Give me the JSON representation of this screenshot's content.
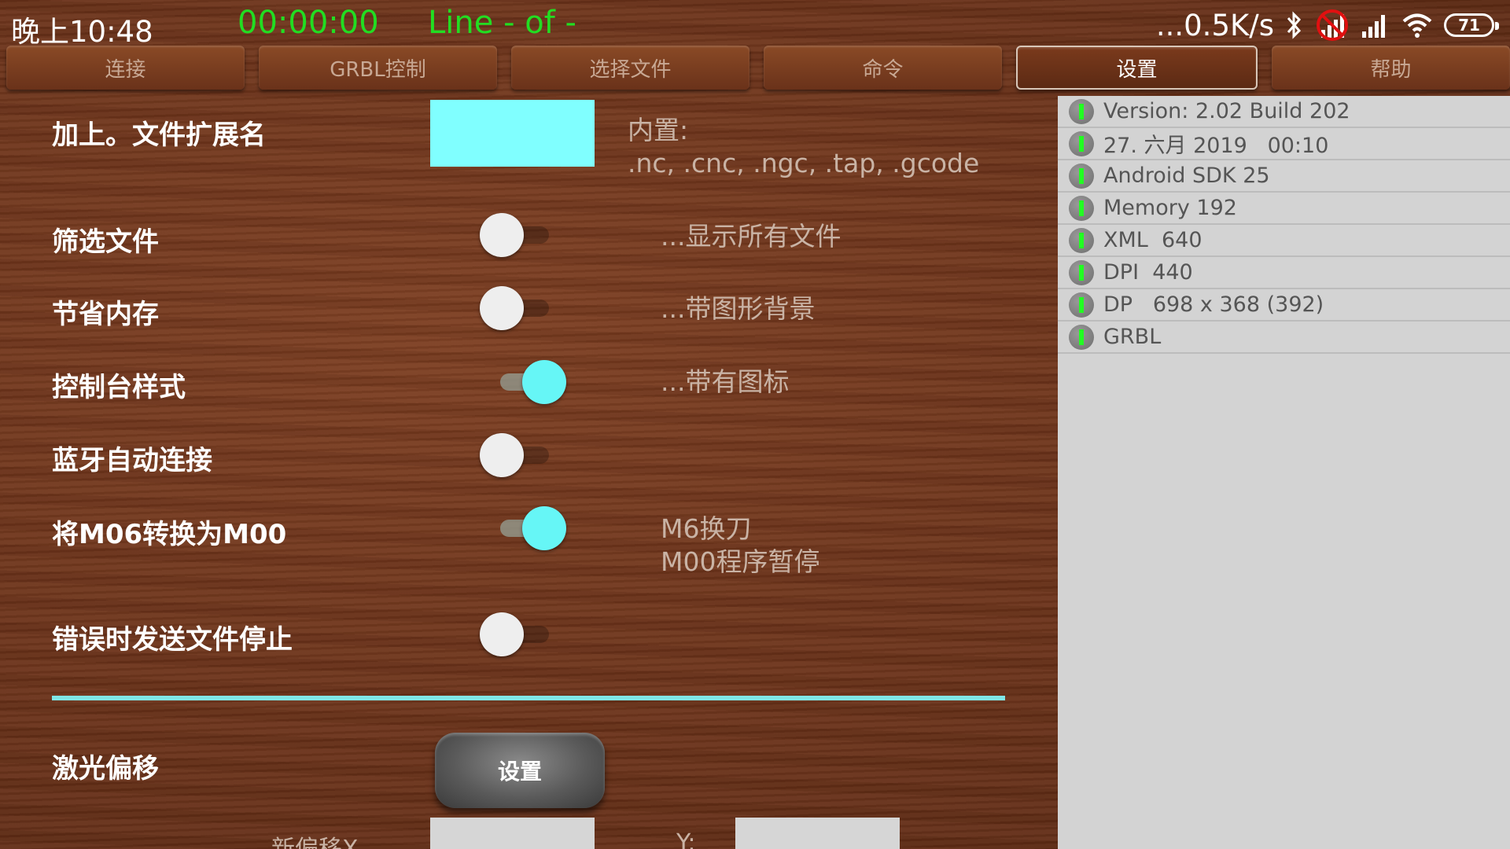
{
  "status_bar": {
    "time": "晚上10:48",
    "timer": "00:00:00",
    "line": "Line - of -",
    "speed": "...0.5K/s",
    "battery": "71",
    "icons": [
      "bluetooth-icon",
      "signal-blocked-icon",
      "signal-icon",
      "wifi-icon",
      "battery-icon"
    ]
  },
  "tabs": [
    {
      "label": "连接",
      "active": false
    },
    {
      "label": "GRBL控制",
      "active": false
    },
    {
      "label": "选择文件",
      "active": false
    },
    {
      "label": "命令",
      "active": false
    },
    {
      "label": "设置",
      "active": true
    },
    {
      "label": "帮助",
      "active": false
    }
  ],
  "settings": {
    "extension": {
      "label": "加上。文件扩展名",
      "value": "",
      "desc": "内置:\n.nc, .cnc, .ngc, .tap, .gcode"
    },
    "filter_files": {
      "label": "筛选文件",
      "on": false,
      "desc": "...显示所有文件"
    },
    "save_memory": {
      "label": "节省内存",
      "on": false,
      "desc": "...带图形背景"
    },
    "console_style": {
      "label": "控制台样式",
      "on": true,
      "desc": "...带有图标"
    },
    "bt_autoconnect": {
      "label": "蓝牙自动连接",
      "on": false,
      "desc": ""
    },
    "m06_to_m00": {
      "label": "将M06转换为M00",
      "on": true,
      "desc": "M6换刀\nM00程序暂停"
    },
    "stop_on_error": {
      "label": "错误时发送文件停止",
      "on": false,
      "desc": ""
    },
    "laser_offset": {
      "label": "激光偏移",
      "button": "设置"
    },
    "new_offset": {
      "label_x": "新偏移X",
      "label_y": "Y:",
      "value_x": "",
      "value_y": ""
    }
  },
  "info": [
    "Version: 2.02 Build 202",
    "27. 六月 2019   00:10",
    "Android SDK 25",
    "Memory 192",
    "XML  640",
    "DPI  440",
    "DP   698 x 368 (392)",
    "GRBL"
  ],
  "colors": {
    "accent_cyan": "#80ffff",
    "timer_green": "#22dd22",
    "info_icon_green": "#22ff22"
  }
}
